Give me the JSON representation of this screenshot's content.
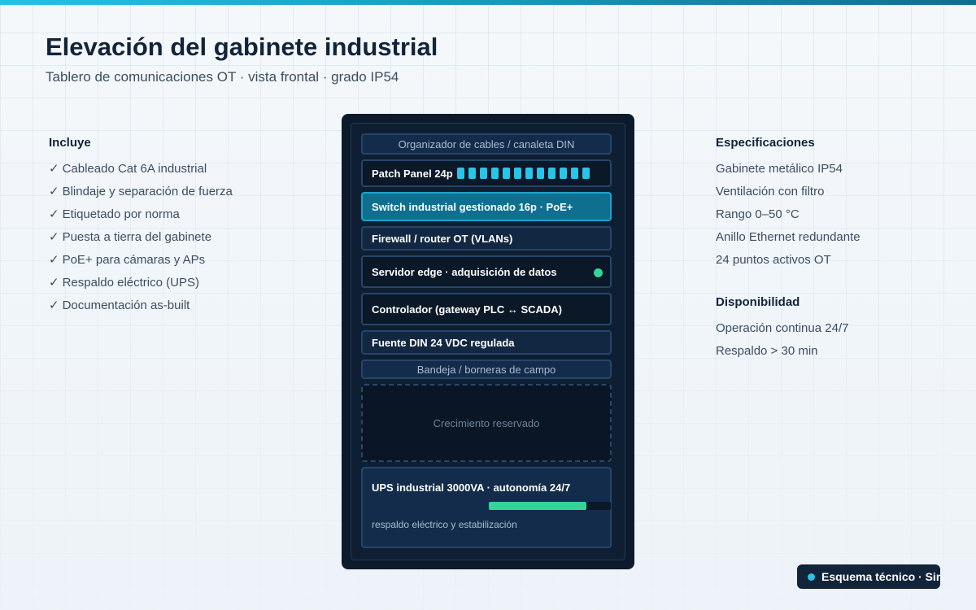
{
  "header": {
    "title": "Elevación del gabinete industrial",
    "subtitle": "Tablero de comunicaciones OT · vista frontal · grado IP54"
  },
  "left_panel": {
    "heading": "Incluye",
    "items": [
      "Cableado Cat 6A industrial",
      "Blindaje y separación de fuerza",
      "Etiquetado por norma",
      "Puesta a tierra del gabinete",
      "PoE+ para cámaras y APs",
      "Respaldo eléctrico (UPS)",
      "Documentación as-built"
    ],
    "check_icon": "✓"
  },
  "right_panel": {
    "specs_heading": "Especificaciones",
    "specs": [
      "Gabinete metálico IP54",
      "Ventilación con filtro",
      "Rango 0–50 °C",
      "Anillo Ethernet redundante",
      "24 puntos activos OT"
    ],
    "availability_heading": "Disponibilidad",
    "availability": [
      "Operación continua 24/7",
      "Respaldo > 30 min"
    ]
  },
  "cabinet": {
    "units": {
      "cable_organizer": "Organizador de cables / canaleta DIN",
      "patch_panel": "Patch Panel 24p",
      "switch": "Switch industrial gestionado 16p · PoE+",
      "firewall": "Firewall / router OT (VLANs)",
      "edge_server": "Servidor edge · adquisición de datos",
      "controller": "Controlador (gateway PLC ↔ SCADA)",
      "power_supply": "Fuente DIN 24 VDC regulada",
      "terminal_tray": "Bandeja / borneras de campo",
      "reserved": "Crecimiento reservado",
      "ups_title": "UPS industrial 3000VA · autonomía 24/7",
      "ups_note": "respaldo eléctrico y estabilización"
    },
    "patch_ports_visible": 12,
    "ups_charge_fraction": 0.8,
    "colors": {
      "port": "#29c5e8",
      "status_led": "#34d399",
      "switch_bg": "#0e6f8f",
      "ups_bar": "#34d399"
    }
  },
  "footer": {
    "badge_text": "Esquema técnico · SimCoder"
  }
}
